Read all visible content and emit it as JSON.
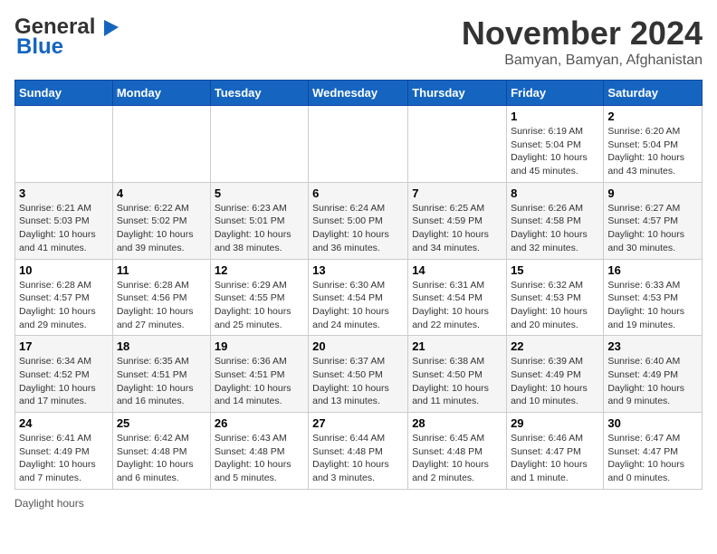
{
  "logo": {
    "line1": "General",
    "line2": "Blue"
  },
  "title": "November 2024",
  "location": "Bamyan, Bamyan, Afghanistan",
  "days_of_week": [
    "Sunday",
    "Monday",
    "Tuesday",
    "Wednesday",
    "Thursday",
    "Friday",
    "Saturday"
  ],
  "footer": "Daylight hours",
  "weeks": [
    [
      {
        "num": "",
        "info": ""
      },
      {
        "num": "",
        "info": ""
      },
      {
        "num": "",
        "info": ""
      },
      {
        "num": "",
        "info": ""
      },
      {
        "num": "",
        "info": ""
      },
      {
        "num": "1",
        "info": "Sunrise: 6:19 AM\nSunset: 5:04 PM\nDaylight: 10 hours\nand 45 minutes."
      },
      {
        "num": "2",
        "info": "Sunrise: 6:20 AM\nSunset: 5:04 PM\nDaylight: 10 hours\nand 43 minutes."
      }
    ],
    [
      {
        "num": "3",
        "info": "Sunrise: 6:21 AM\nSunset: 5:03 PM\nDaylight: 10 hours\nand 41 minutes."
      },
      {
        "num": "4",
        "info": "Sunrise: 6:22 AM\nSunset: 5:02 PM\nDaylight: 10 hours\nand 39 minutes."
      },
      {
        "num": "5",
        "info": "Sunrise: 6:23 AM\nSunset: 5:01 PM\nDaylight: 10 hours\nand 38 minutes."
      },
      {
        "num": "6",
        "info": "Sunrise: 6:24 AM\nSunset: 5:00 PM\nDaylight: 10 hours\nand 36 minutes."
      },
      {
        "num": "7",
        "info": "Sunrise: 6:25 AM\nSunset: 4:59 PM\nDaylight: 10 hours\nand 34 minutes."
      },
      {
        "num": "8",
        "info": "Sunrise: 6:26 AM\nSunset: 4:58 PM\nDaylight: 10 hours\nand 32 minutes."
      },
      {
        "num": "9",
        "info": "Sunrise: 6:27 AM\nSunset: 4:57 PM\nDaylight: 10 hours\nand 30 minutes."
      }
    ],
    [
      {
        "num": "10",
        "info": "Sunrise: 6:28 AM\nSunset: 4:57 PM\nDaylight: 10 hours\nand 29 minutes."
      },
      {
        "num": "11",
        "info": "Sunrise: 6:28 AM\nSunset: 4:56 PM\nDaylight: 10 hours\nand 27 minutes."
      },
      {
        "num": "12",
        "info": "Sunrise: 6:29 AM\nSunset: 4:55 PM\nDaylight: 10 hours\nand 25 minutes."
      },
      {
        "num": "13",
        "info": "Sunrise: 6:30 AM\nSunset: 4:54 PM\nDaylight: 10 hours\nand 24 minutes."
      },
      {
        "num": "14",
        "info": "Sunrise: 6:31 AM\nSunset: 4:54 PM\nDaylight: 10 hours\nand 22 minutes."
      },
      {
        "num": "15",
        "info": "Sunrise: 6:32 AM\nSunset: 4:53 PM\nDaylight: 10 hours\nand 20 minutes."
      },
      {
        "num": "16",
        "info": "Sunrise: 6:33 AM\nSunset: 4:53 PM\nDaylight: 10 hours\nand 19 minutes."
      }
    ],
    [
      {
        "num": "17",
        "info": "Sunrise: 6:34 AM\nSunset: 4:52 PM\nDaylight: 10 hours\nand 17 minutes."
      },
      {
        "num": "18",
        "info": "Sunrise: 6:35 AM\nSunset: 4:51 PM\nDaylight: 10 hours\nand 16 minutes."
      },
      {
        "num": "19",
        "info": "Sunrise: 6:36 AM\nSunset: 4:51 PM\nDaylight: 10 hours\nand 14 minutes."
      },
      {
        "num": "20",
        "info": "Sunrise: 6:37 AM\nSunset: 4:50 PM\nDaylight: 10 hours\nand 13 minutes."
      },
      {
        "num": "21",
        "info": "Sunrise: 6:38 AM\nSunset: 4:50 PM\nDaylight: 10 hours\nand 11 minutes."
      },
      {
        "num": "22",
        "info": "Sunrise: 6:39 AM\nSunset: 4:49 PM\nDaylight: 10 hours\nand 10 minutes."
      },
      {
        "num": "23",
        "info": "Sunrise: 6:40 AM\nSunset: 4:49 PM\nDaylight: 10 hours\nand 9 minutes."
      }
    ],
    [
      {
        "num": "24",
        "info": "Sunrise: 6:41 AM\nSunset: 4:49 PM\nDaylight: 10 hours\nand 7 minutes."
      },
      {
        "num": "25",
        "info": "Sunrise: 6:42 AM\nSunset: 4:48 PM\nDaylight: 10 hours\nand 6 minutes."
      },
      {
        "num": "26",
        "info": "Sunrise: 6:43 AM\nSunset: 4:48 PM\nDaylight: 10 hours\nand 5 minutes."
      },
      {
        "num": "27",
        "info": "Sunrise: 6:44 AM\nSunset: 4:48 PM\nDaylight: 10 hours\nand 3 minutes."
      },
      {
        "num": "28",
        "info": "Sunrise: 6:45 AM\nSunset: 4:48 PM\nDaylight: 10 hours\nand 2 minutes."
      },
      {
        "num": "29",
        "info": "Sunrise: 6:46 AM\nSunset: 4:47 PM\nDaylight: 10 hours\nand 1 minute."
      },
      {
        "num": "30",
        "info": "Sunrise: 6:47 AM\nSunset: 4:47 PM\nDaylight: 10 hours\nand 0 minutes."
      }
    ]
  ]
}
